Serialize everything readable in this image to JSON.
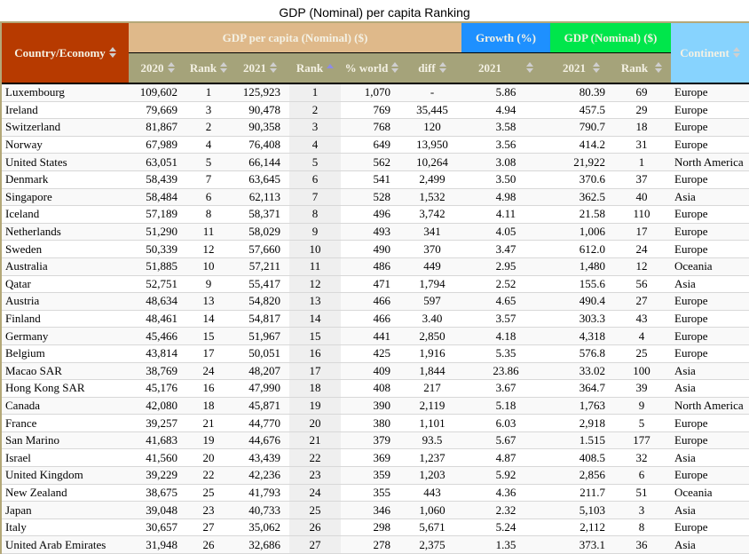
{
  "title": "GDP (Nominal) per capita Ranking",
  "header": {
    "country": "Country/Economy",
    "group_gdp_per_capita": "GDP per capita (Nominal) ($)",
    "group_growth": "Growth (%)",
    "group_gdp_nominal": "GDP (Nominal) ($)",
    "continent": "Continent",
    "sub": {
      "y2020": "2020",
      "rank2020": "Rank",
      "y2021": "2021",
      "rank2021": "Rank",
      "pct_world": "% world",
      "diff": "diff",
      "growth2021": "2021",
      "gdp2021": "2021",
      "gdp_rank": "Rank"
    },
    "sorted_column": "rank2021",
    "sort_direction": "ascending"
  },
  "colors": {
    "country_header": "#b73a00",
    "gdp_per_capita_header": "#dfb98a",
    "growth_header": "#1e90ff",
    "gdp_nominal_header": "#00e64b",
    "continent_header": "#87d3fe",
    "subheader": "#a5a37a"
  },
  "rows": [
    {
      "country": "Luxembourg",
      "v2020": "109,602",
      "r2020": "1",
      "v2021": "125,923",
      "r2021": "1",
      "world": "1,070",
      "diff": "-",
      "growth": "5.86",
      "gdp": "80.39",
      "gdp_rank": "69",
      "continent": "Europe"
    },
    {
      "country": "Ireland",
      "v2020": "79,669",
      "r2020": "3",
      "v2021": "90,478",
      "r2021": "2",
      "world": "769",
      "diff": "35,445",
      "growth": "4.94",
      "gdp": "457.5",
      "gdp_rank": "29",
      "continent": "Europe"
    },
    {
      "country": "Switzerland",
      "v2020": "81,867",
      "r2020": "2",
      "v2021": "90,358",
      "r2021": "3",
      "world": "768",
      "diff": "120",
      "growth": "3.58",
      "gdp": "790.7",
      "gdp_rank": "18",
      "continent": "Europe"
    },
    {
      "country": "Norway",
      "v2020": "67,989",
      "r2020": "4",
      "v2021": "76,408",
      "r2021": "4",
      "world": "649",
      "diff": "13,950",
      "growth": "3.56",
      "gdp": "414.2",
      "gdp_rank": "31",
      "continent": "Europe"
    },
    {
      "country": "United States",
      "v2020": "63,051",
      "r2020": "5",
      "v2021": "66,144",
      "r2021": "5",
      "world": "562",
      "diff": "10,264",
      "growth": "3.08",
      "gdp": "21,922",
      "gdp_rank": "1",
      "continent": "North America"
    },
    {
      "country": "Denmark",
      "v2020": "58,439",
      "r2020": "7",
      "v2021": "63,645",
      "r2021": "6",
      "world": "541",
      "diff": "2,499",
      "growth": "3.50",
      "gdp": "370.6",
      "gdp_rank": "37",
      "continent": "Europe"
    },
    {
      "country": "Singapore",
      "v2020": "58,484",
      "r2020": "6",
      "v2021": "62,113",
      "r2021": "7",
      "world": "528",
      "diff": "1,532",
      "growth": "4.98",
      "gdp": "362.5",
      "gdp_rank": "40",
      "continent": "Asia"
    },
    {
      "country": "Iceland",
      "v2020": "57,189",
      "r2020": "8",
      "v2021": "58,371",
      "r2021": "8",
      "world": "496",
      "diff": "3,742",
      "growth": "4.11",
      "gdp": "21.58",
      "gdp_rank": "110",
      "continent": "Europe"
    },
    {
      "country": "Netherlands",
      "v2020": "51,290",
      "r2020": "11",
      "v2021": "58,029",
      "r2021": "9",
      "world": "493",
      "diff": "341",
      "growth": "4.05",
      "gdp": "1,006",
      "gdp_rank": "17",
      "continent": "Europe"
    },
    {
      "country": "Sweden",
      "v2020": "50,339",
      "r2020": "12",
      "v2021": "57,660",
      "r2021": "10",
      "world": "490",
      "diff": "370",
      "growth": "3.47",
      "gdp": "612.0",
      "gdp_rank": "24",
      "continent": "Europe"
    },
    {
      "country": "Australia",
      "v2020": "51,885",
      "r2020": "10",
      "v2021": "57,211",
      "r2021": "11",
      "world": "486",
      "diff": "449",
      "growth": "2.95",
      "gdp": "1,480",
      "gdp_rank": "12",
      "continent": "Oceania"
    },
    {
      "country": "Qatar",
      "v2020": "52,751",
      "r2020": "9",
      "v2021": "55,417",
      "r2021": "12",
      "world": "471",
      "diff": "1,794",
      "growth": "2.52",
      "gdp": "155.6",
      "gdp_rank": "56",
      "continent": "Asia"
    },
    {
      "country": "Austria",
      "v2020": "48,634",
      "r2020": "13",
      "v2021": "54,820",
      "r2021": "13",
      "world": "466",
      "diff": "597",
      "growth": "4.65",
      "gdp": "490.4",
      "gdp_rank": "27",
      "continent": "Europe"
    },
    {
      "country": "Finland",
      "v2020": "48,461",
      "r2020": "14",
      "v2021": "54,817",
      "r2021": "14",
      "world": "466",
      "diff": "3.40",
      "growth": "3.57",
      "gdp": "303.3",
      "gdp_rank": "43",
      "continent": "Europe"
    },
    {
      "country": "Germany",
      "v2020": "45,466",
      "r2020": "15",
      "v2021": "51,967",
      "r2021": "15",
      "world": "441",
      "diff": "2,850",
      "growth": "4.18",
      "gdp": "4,318",
      "gdp_rank": "4",
      "continent": "Europe"
    },
    {
      "country": "Belgium",
      "v2020": "43,814",
      "r2020": "17",
      "v2021": "50,051",
      "r2021": "16",
      "world": "425",
      "diff": "1,916",
      "growth": "5.35",
      "gdp": "576.8",
      "gdp_rank": "25",
      "continent": "Europe"
    },
    {
      "country": "Macao SAR",
      "v2020": "38,769",
      "r2020": "24",
      "v2021": "48,207",
      "r2021": "17",
      "world": "409",
      "diff": "1,844",
      "growth": "23.86",
      "gdp": "33.02",
      "gdp_rank": "100",
      "continent": "Asia"
    },
    {
      "country": "Hong Kong SAR",
      "v2020": "45,176",
      "r2020": "16",
      "v2021": "47,990",
      "r2021": "18",
      "world": "408",
      "diff": "217",
      "growth": "3.67",
      "gdp": "364.7",
      "gdp_rank": "39",
      "continent": "Asia"
    },
    {
      "country": "Canada",
      "v2020": "42,080",
      "r2020": "18",
      "v2021": "45,871",
      "r2021": "19",
      "world": "390",
      "diff": "2,119",
      "growth": "5.18",
      "gdp": "1,763",
      "gdp_rank": "9",
      "continent": "North America"
    },
    {
      "country": "France",
      "v2020": "39,257",
      "r2020": "21",
      "v2021": "44,770",
      "r2021": "20",
      "world": "380",
      "diff": "1,101",
      "growth": "6.03",
      "gdp": "2,918",
      "gdp_rank": "5",
      "continent": "Europe"
    },
    {
      "country": "San Marino",
      "v2020": "41,683",
      "r2020": "19",
      "v2021": "44,676",
      "r2021": "21",
      "world": "379",
      "diff": "93.5",
      "growth": "5.67",
      "gdp": "1.515",
      "gdp_rank": "177",
      "continent": "Europe"
    },
    {
      "country": "Israel",
      "v2020": "41,560",
      "r2020": "20",
      "v2021": "43,439",
      "r2021": "22",
      "world": "369",
      "diff": "1,237",
      "growth": "4.87",
      "gdp": "408.5",
      "gdp_rank": "32",
      "continent": "Asia"
    },
    {
      "country": "United Kingdom",
      "v2020": "39,229",
      "r2020": "22",
      "v2021": "42,236",
      "r2021": "23",
      "world": "359",
      "diff": "1,203",
      "growth": "5.92",
      "gdp": "2,856",
      "gdp_rank": "6",
      "continent": "Europe"
    },
    {
      "country": "New Zealand",
      "v2020": "38,675",
      "r2020": "25",
      "v2021": "41,793",
      "r2021": "24",
      "world": "355",
      "diff": "443",
      "growth": "4.36",
      "gdp": "211.7",
      "gdp_rank": "51",
      "continent": "Oceania"
    },
    {
      "country": "Japan",
      "v2020": "39,048",
      "r2020": "23",
      "v2021": "40,733",
      "r2021": "25",
      "world": "346",
      "diff": "1,060",
      "growth": "2.32",
      "gdp": "5,103",
      "gdp_rank": "3",
      "continent": "Asia"
    },
    {
      "country": "Italy",
      "v2020": "30,657",
      "r2020": "27",
      "v2021": "35,062",
      "r2021": "26",
      "world": "298",
      "diff": "5,671",
      "growth": "5.24",
      "gdp": "2,112",
      "gdp_rank": "8",
      "continent": "Europe"
    },
    {
      "country": "United Arab Emirates",
      "v2020": "31,948",
      "r2020": "26",
      "v2021": "32,686",
      "r2021": "27",
      "world": "278",
      "diff": "2,375",
      "growth": "1.35",
      "gdp": "373.1",
      "gdp_rank": "36",
      "continent": "Asia"
    }
  ]
}
